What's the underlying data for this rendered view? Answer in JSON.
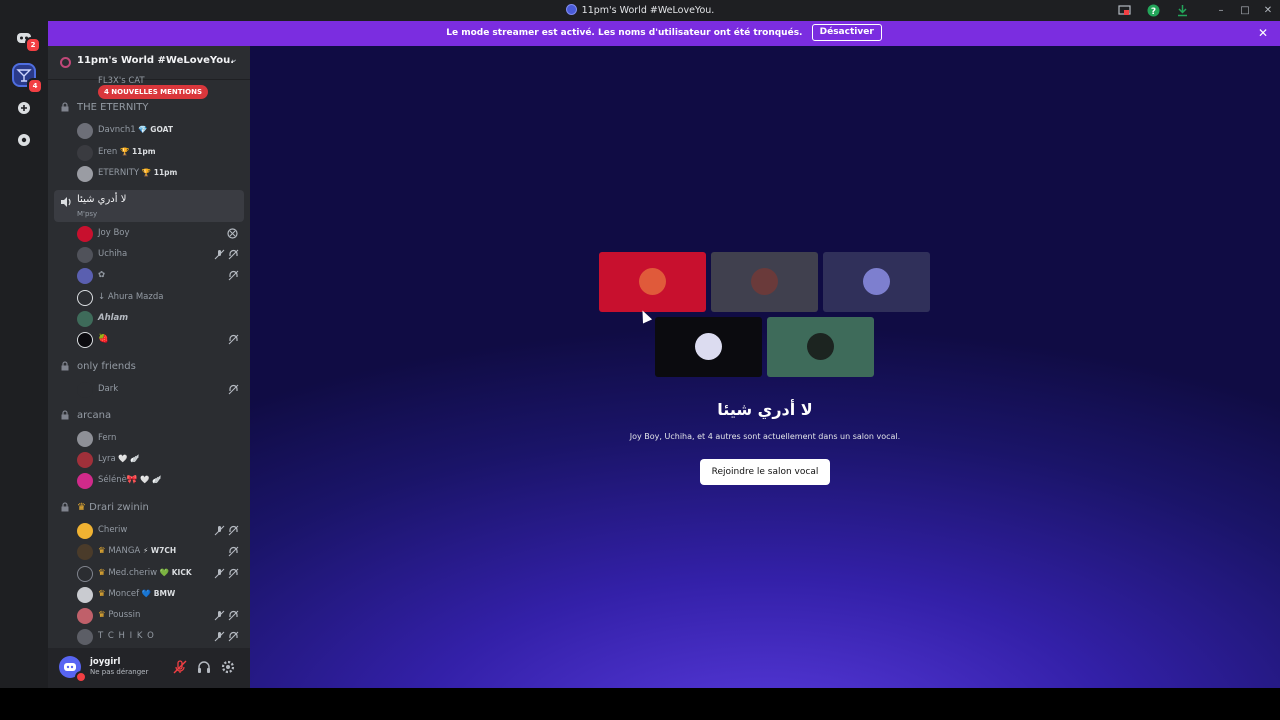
{
  "window": {
    "title": "11pm's World #WeLoveYou.",
    "controls": {
      "minimize": "–",
      "maximize": "□",
      "close": "✕"
    },
    "toolbar_icons": [
      "screen-share-icon",
      "help-icon",
      "download-icon"
    ]
  },
  "rail": {
    "home_badge": "2",
    "server_badge": "4",
    "add_icon": "+",
    "explore_icon": "compass-icon"
  },
  "banner": {
    "text": "Le mode streamer est activé. Les noms d'utilisateur ont été tronqués.",
    "button": "Désactiver",
    "close": "✕",
    "color": "#7b2de0"
  },
  "server": {
    "name": "11pm's World #WeLoveYou.",
    "mentions_pill": "4 NOUVELLES MENTIONS",
    "partial_top_item": "FL3X's CAT"
  },
  "channels": [
    {
      "name": "THE ETERNITY",
      "locked": true,
      "members": [
        {
          "name": "Davnch1",
          "tag": "💎 GOAT"
        },
        {
          "name": "Eren",
          "tag": "🏆 11pm"
        },
        {
          "name": "ETERNITY",
          "tag": "🏆 11pm"
        }
      ]
    },
    {
      "name": "لا أدري شيئا",
      "status": "M'psy",
      "active": true,
      "members": [
        {
          "name": "Joy Boy",
          "tag": ""
        },
        {
          "name": "Uchiha",
          "tag": ""
        },
        {
          "name": "✿",
          "tag": ""
        },
        {
          "name": "↓ Ahura Mazda",
          "tag": ""
        },
        {
          "name": "Ahlam",
          "tag": ""
        },
        {
          "name": "🍓",
          "tag": ""
        }
      ]
    },
    {
      "name": "only friends",
      "locked": true,
      "members": [
        {
          "name": "Dark",
          "tag": ""
        }
      ]
    },
    {
      "name": "arcana",
      "locked": true,
      "members": [
        {
          "name": "Fern",
          "tag": ""
        },
        {
          "name": "Lyra",
          "tag": "🤍 🪽"
        },
        {
          "name": "Sélénè🎀",
          "tag": "🤍 🪽"
        }
      ]
    },
    {
      "name": "Drari zwinin",
      "locked": true,
      "members": [
        {
          "name": "Cheriw",
          "tag": ""
        },
        {
          "name": "MANGA",
          "tag": "⚡ W7CH"
        },
        {
          "name": "Med.cheriw",
          "tag": "💚 KICK"
        },
        {
          "name": "Moncef",
          "tag": "💙 BMW"
        },
        {
          "name": "Poussin",
          "tag": ""
        },
        {
          "name": "T C H I K O",
          "tag": ""
        }
      ]
    }
  ],
  "user": {
    "name": "joygirl",
    "status": "Ne pas déranger"
  },
  "voice": {
    "channel_name": "لا أدري شيئا",
    "subtitle": "Joy Boy, Uchiha, et 4 autres sont actuellement dans un salon vocal.",
    "join_button": "Rejoindre le salon vocal",
    "tile_colors": [
      "#c8102e",
      "#40404e",
      "#30305a",
      "#0b0b0f",
      "#3e6b5a"
    ]
  }
}
